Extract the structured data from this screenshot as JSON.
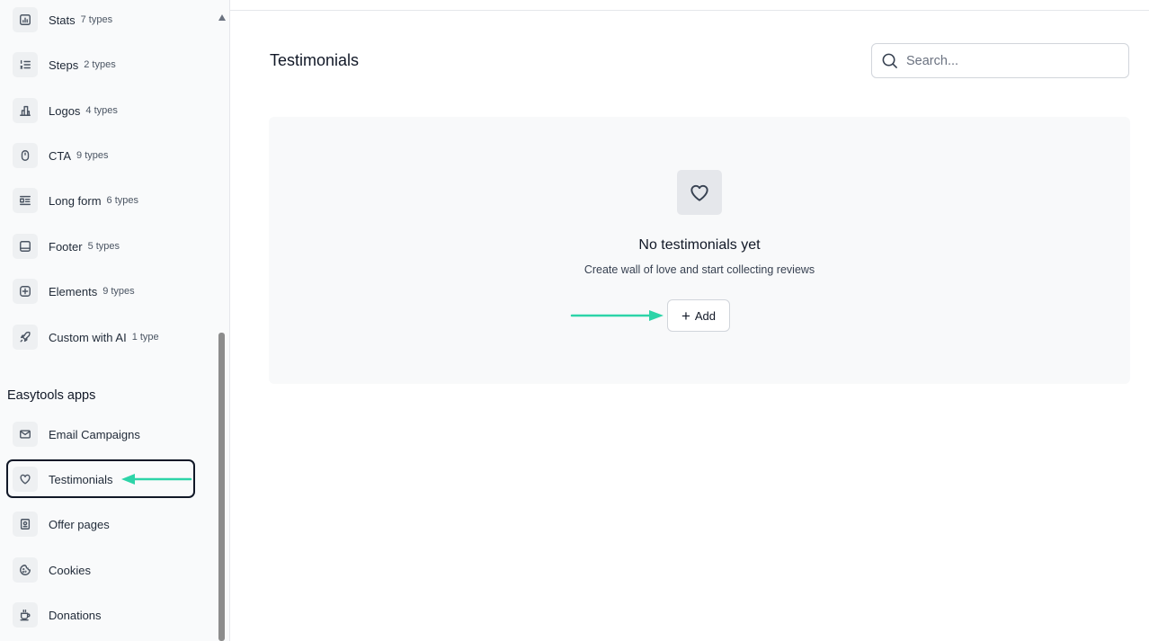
{
  "sidebar": {
    "blocks": [
      {
        "label": "Stats",
        "count": "7 types",
        "icon": "stats-icon"
      },
      {
        "label": "Steps",
        "count": "2 types",
        "icon": "steps-icon"
      },
      {
        "label": "Logos",
        "count": "4 types",
        "icon": "logos-icon"
      },
      {
        "label": "CTA",
        "count": "9 types",
        "icon": "cta-icon"
      },
      {
        "label": "Long form",
        "count": "6 types",
        "icon": "long-form-icon"
      },
      {
        "label": "Footer",
        "count": "5 types",
        "icon": "footer-icon"
      },
      {
        "label": "Elements",
        "count": "9 types",
        "icon": "elements-icon"
      },
      {
        "label": "Custom with AI",
        "count": "1 type",
        "icon": "rocket-icon"
      }
    ],
    "apps_title": "Easytools apps",
    "apps": [
      {
        "label": "Email Campaigns",
        "icon": "mail-icon"
      },
      {
        "label": "Testimonials",
        "icon": "heart-icon"
      },
      {
        "label": "Offer pages",
        "icon": "offer-icon"
      },
      {
        "label": "Cookies",
        "icon": "cookie-icon"
      },
      {
        "label": "Donations",
        "icon": "coffee-icon"
      }
    ]
  },
  "main": {
    "title": "Testimonials",
    "search_placeholder": "Search...",
    "empty_title": "No testimonials yet",
    "empty_subtitle": "Create wall of love and start collecting reviews",
    "add_label": "Add"
  },
  "colors": {
    "annotation_arrow": "#2dd4a8",
    "highlight_border": "#111827"
  }
}
